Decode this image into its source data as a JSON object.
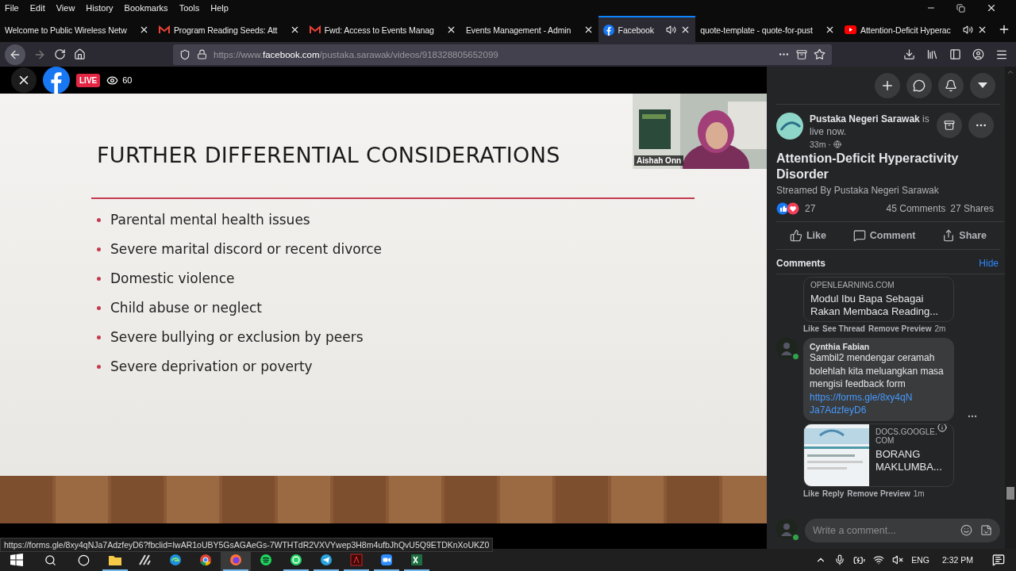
{
  "menu": [
    "File",
    "Edit",
    "View",
    "History",
    "Bookmarks",
    "Tools",
    "Help"
  ],
  "tabs": [
    {
      "title": "Welcome to Public Wireless Netw",
      "kind": "plain",
      "audio": false,
      "selected": false
    },
    {
      "title": "Program Reading Seeds: Att",
      "kind": "gmail",
      "audio": false,
      "selected": false
    },
    {
      "title": "Fwd: Access to Events Manag",
      "kind": "gmail",
      "audio": false,
      "selected": false
    },
    {
      "title": "Events Management - Admin",
      "kind": "plain",
      "audio": false,
      "selected": false
    },
    {
      "title": "Facebook",
      "kind": "facebook",
      "audio": true,
      "selected": true
    },
    {
      "title": "quote-template - quote-for-pust",
      "kind": "plain",
      "audio": false,
      "selected": false
    },
    {
      "title": "Attention-Deficit Hyperac",
      "kind": "youtube",
      "audio": true,
      "selected": false
    }
  ],
  "address": {
    "scheme": "https://www.",
    "host": "facebook.com",
    "path": "/pustaka.sarawak/videos/918328805652099"
  },
  "video": {
    "live": "LIVE",
    "viewers": "60",
    "speaker": "Aishah Onn",
    "slide": {
      "title": "FURTHER DIFFERENTIAL CONSIDERATIONS",
      "bullets": [
        "Parental mental health issues",
        "Severe marital discord or recent divorce",
        "Domestic violence",
        "Child abuse or neglect",
        "Severe bullying or exclusion by peers",
        "Severe deprivation or poverty"
      ]
    }
  },
  "post": {
    "headline": "**Pustaka Negeri Sarawak** is live now.",
    "time": "33m ·",
    "title": "Attention-Deficit Hyperactivity Disorder",
    "streamed_by": "Streamed By Pustaka Negeri Sarawak",
    "reactions": "27",
    "comments": "45 Comments",
    "shares": "27 Shares",
    "actions": [
      "Like",
      "Comment",
      "Share"
    ]
  },
  "comments": {
    "heading": "Comments",
    "hide": "Hide",
    "items": [
      {
        "kind": "preview",
        "domain": "OPENLEARNING.COM",
        "preview_title": "Modul Ibu Bapa Sebagai Rakan Membaca Reading...",
        "actions": [
          "Like",
          "See Thread",
          "Remove Preview"
        ],
        "time": "2m"
      },
      {
        "kind": "comment",
        "author": "Cynthia Fabian",
        "text": "Sambil2 mendengar ceramah bolehlah kita meluangkan masa mengisi feedback form",
        "link": "https://forms.gle/8xy4qNJa7AdzfeyD6",
        "domain": "DOCS.GOOGLE.COM",
        "preview_title": "BORANG MAKLUMBA...",
        "actions": [
          "Like",
          "Reply",
          "Remove Preview"
        ],
        "time": "1m"
      }
    ],
    "placeholder": "Write a comment..."
  },
  "status_url": "https://forms.gle/8xy4qNJa7AdzfeyD6?fbclid=IwAR1oUBY5GsAGAeGs-7WTHTdR2VXVYwep3H8m4ufbJhQvU5Q9ETDKnXoUKZ0",
  "taskbar": {
    "apps": [
      {
        "kind": "explorer",
        "running": true,
        "selected": false
      },
      {
        "kind": "pen",
        "running": false,
        "selected": false
      },
      {
        "kind": "edge",
        "running": false,
        "selected": false
      },
      {
        "kind": "chrome",
        "running": false,
        "selected": false
      },
      {
        "kind": "firefox",
        "running": true,
        "selected": true
      },
      {
        "kind": "spotify",
        "running": false,
        "selected": false
      },
      {
        "kind": "whatsapp",
        "running": true,
        "selected": false
      },
      {
        "kind": "telegram",
        "running": true,
        "selected": false
      },
      {
        "kind": "acrobat",
        "running": true,
        "selected": false
      },
      {
        "kind": "zoom",
        "running": true,
        "selected": false
      },
      {
        "kind": "excel",
        "running": true,
        "selected": false
      }
    ],
    "language": "ENG",
    "time": "2:32 PM"
  }
}
